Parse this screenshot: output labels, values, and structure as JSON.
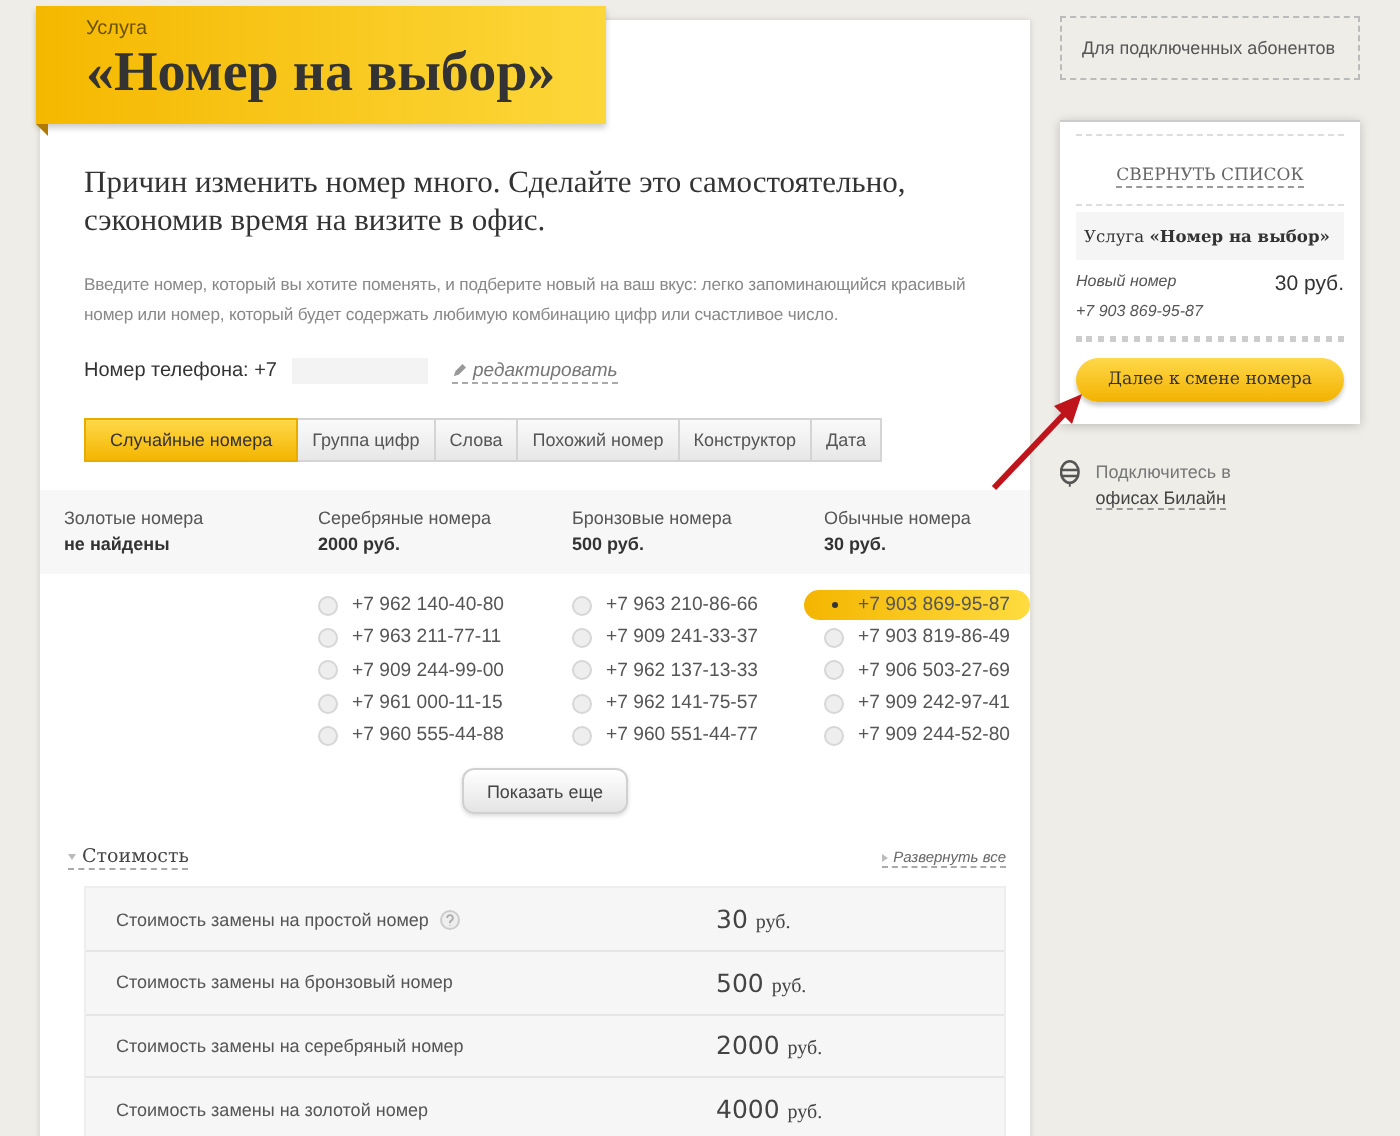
{
  "banner": {
    "label": "Услуга",
    "title": "«Номер на выбор»"
  },
  "lead": "Причин изменить номер много. Сделайте это самостоятельно, сэкономив время на визите в офис.",
  "description": "Введите номер, который вы хотите поменять, и подберите новый на ваш вкус: легко запоминающийся красивый номер или номер, который будет содержать любимую комбинацию цифр или счастливое число.",
  "phone": {
    "label": "Номер телефона: +7",
    "edit_link": "редактировать"
  },
  "tabs": [
    {
      "label": "Случайные номера",
      "selected": true
    },
    {
      "label": "Группа цифр",
      "selected": false
    },
    {
      "label": "Слова",
      "selected": false
    },
    {
      "label": "Похожий номер",
      "selected": false
    },
    {
      "label": "Конструктор",
      "selected": false
    },
    {
      "label": "Дата",
      "selected": false
    }
  ],
  "number_groups": [
    {
      "title": "Золотые номера",
      "price": "не найдены"
    },
    {
      "title": "Серебряные номера",
      "price": "2000 руб.",
      "numbers": [
        {
          "number": "+7 962 140-40-80",
          "selected": false
        },
        {
          "number": "+7 963 211-77-11",
          "selected": false
        },
        {
          "number": "+7 909 244-99-00",
          "selected": false
        },
        {
          "number": "+7 961 000-11-15",
          "selected": false
        },
        {
          "number": "+7 960 555-44-88",
          "selected": false
        }
      ]
    },
    {
      "title": "Бронзовые номера",
      "price": "500 руб.",
      "numbers": [
        {
          "number": "+7 963 210-86-66",
          "selected": false
        },
        {
          "number": "+7 909 241-33-37",
          "selected": false
        },
        {
          "number": "+7 962 137-13-33",
          "selected": false
        },
        {
          "number": "+7 962 141-75-57",
          "selected": false
        },
        {
          "number": "+7 960 551-44-77",
          "selected": false
        }
      ]
    },
    {
      "title": "Обычные номера",
      "price": "30 руб.",
      "numbers": [
        {
          "number": "+7 903 869-95-87",
          "selected": true
        },
        {
          "number": "+7 903 819-86-49",
          "selected": false
        },
        {
          "number": "+7 906 503-27-69",
          "selected": false
        },
        {
          "number": "+7 909 242-97-41",
          "selected": false
        },
        {
          "number": "+7 909 244-52-80",
          "selected": false
        }
      ]
    }
  ],
  "show_more": "Показать еще",
  "cost_section": {
    "title": "Стоимость",
    "expand_link": "Развернуть все",
    "rows": [
      {
        "label": "Стоимость замены на простой номер",
        "help": true,
        "amount": "30",
        "currency": "руб."
      },
      {
        "label": "Стоимость замены на бронзовый номер",
        "help": false,
        "amount": "500",
        "currency": "руб."
      },
      {
        "label": "Стоимость замены на серебряный номер",
        "help": false,
        "amount": "2000",
        "currency": "руб."
      },
      {
        "label": "Стоимость замены на золотой номер",
        "help": false,
        "amount": "4000",
        "currency": "руб."
      }
    ]
  },
  "sidebar": {
    "subscriber_link": "Для подключенных абонентов",
    "collapse_link": "СВЕРНУТЬ СПИСОК",
    "service": "Услуга **«Номер на выбор»**",
    "new_number_label": "Новый номер",
    "new_number": "+7 903 869-95-87",
    "price": "30 руб.",
    "next_button": "Далее к смене номера",
    "offices_text": "Подключитесь в",
    "offices_link": "офисах Билайн"
  }
}
